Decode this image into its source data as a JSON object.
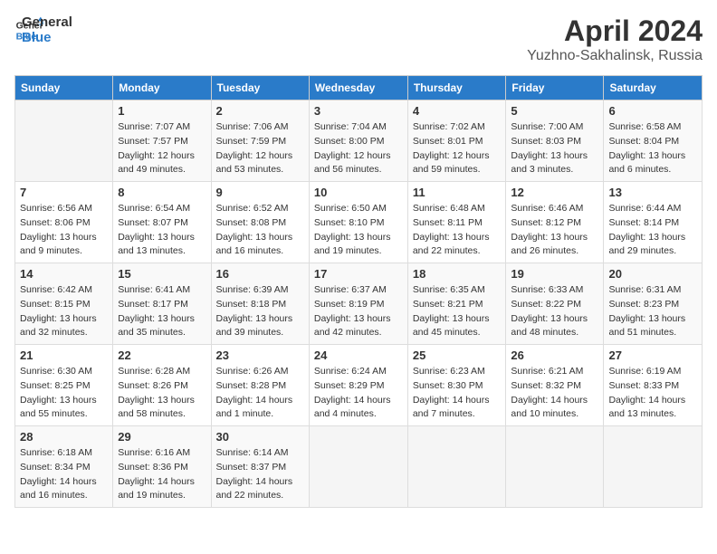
{
  "header": {
    "logo_line1": "General",
    "logo_line2": "Blue",
    "month_year": "April 2024",
    "location": "Yuzhno-Sakhalinsk, Russia"
  },
  "weekdays": [
    "Sunday",
    "Monday",
    "Tuesday",
    "Wednesday",
    "Thursday",
    "Friday",
    "Saturday"
  ],
  "weeks": [
    [
      {
        "day": "",
        "sunrise": "",
        "sunset": "",
        "daylight": ""
      },
      {
        "day": "1",
        "sunrise": "Sunrise: 7:07 AM",
        "sunset": "Sunset: 7:57 PM",
        "daylight": "Daylight: 12 hours and 49 minutes."
      },
      {
        "day": "2",
        "sunrise": "Sunrise: 7:06 AM",
        "sunset": "Sunset: 7:59 PM",
        "daylight": "Daylight: 12 hours and 53 minutes."
      },
      {
        "day": "3",
        "sunrise": "Sunrise: 7:04 AM",
        "sunset": "Sunset: 8:00 PM",
        "daylight": "Daylight: 12 hours and 56 minutes."
      },
      {
        "day": "4",
        "sunrise": "Sunrise: 7:02 AM",
        "sunset": "Sunset: 8:01 PM",
        "daylight": "Daylight: 12 hours and 59 minutes."
      },
      {
        "day": "5",
        "sunrise": "Sunrise: 7:00 AM",
        "sunset": "Sunset: 8:03 PM",
        "daylight": "Daylight: 13 hours and 3 minutes."
      },
      {
        "day": "6",
        "sunrise": "Sunrise: 6:58 AM",
        "sunset": "Sunset: 8:04 PM",
        "daylight": "Daylight: 13 hours and 6 minutes."
      }
    ],
    [
      {
        "day": "7",
        "sunrise": "Sunrise: 6:56 AM",
        "sunset": "Sunset: 8:06 PM",
        "daylight": "Daylight: 13 hours and 9 minutes."
      },
      {
        "day": "8",
        "sunrise": "Sunrise: 6:54 AM",
        "sunset": "Sunset: 8:07 PM",
        "daylight": "Daylight: 13 hours and 13 minutes."
      },
      {
        "day": "9",
        "sunrise": "Sunrise: 6:52 AM",
        "sunset": "Sunset: 8:08 PM",
        "daylight": "Daylight: 13 hours and 16 minutes."
      },
      {
        "day": "10",
        "sunrise": "Sunrise: 6:50 AM",
        "sunset": "Sunset: 8:10 PM",
        "daylight": "Daylight: 13 hours and 19 minutes."
      },
      {
        "day": "11",
        "sunrise": "Sunrise: 6:48 AM",
        "sunset": "Sunset: 8:11 PM",
        "daylight": "Daylight: 13 hours and 22 minutes."
      },
      {
        "day": "12",
        "sunrise": "Sunrise: 6:46 AM",
        "sunset": "Sunset: 8:12 PM",
        "daylight": "Daylight: 13 hours and 26 minutes."
      },
      {
        "day": "13",
        "sunrise": "Sunrise: 6:44 AM",
        "sunset": "Sunset: 8:14 PM",
        "daylight": "Daylight: 13 hours and 29 minutes."
      }
    ],
    [
      {
        "day": "14",
        "sunrise": "Sunrise: 6:42 AM",
        "sunset": "Sunset: 8:15 PM",
        "daylight": "Daylight: 13 hours and 32 minutes."
      },
      {
        "day": "15",
        "sunrise": "Sunrise: 6:41 AM",
        "sunset": "Sunset: 8:17 PM",
        "daylight": "Daylight: 13 hours and 35 minutes."
      },
      {
        "day": "16",
        "sunrise": "Sunrise: 6:39 AM",
        "sunset": "Sunset: 8:18 PM",
        "daylight": "Daylight: 13 hours and 39 minutes."
      },
      {
        "day": "17",
        "sunrise": "Sunrise: 6:37 AM",
        "sunset": "Sunset: 8:19 PM",
        "daylight": "Daylight: 13 hours and 42 minutes."
      },
      {
        "day": "18",
        "sunrise": "Sunrise: 6:35 AM",
        "sunset": "Sunset: 8:21 PM",
        "daylight": "Daylight: 13 hours and 45 minutes."
      },
      {
        "day": "19",
        "sunrise": "Sunrise: 6:33 AM",
        "sunset": "Sunset: 8:22 PM",
        "daylight": "Daylight: 13 hours and 48 minutes."
      },
      {
        "day": "20",
        "sunrise": "Sunrise: 6:31 AM",
        "sunset": "Sunset: 8:23 PM",
        "daylight": "Daylight: 13 hours and 51 minutes."
      }
    ],
    [
      {
        "day": "21",
        "sunrise": "Sunrise: 6:30 AM",
        "sunset": "Sunset: 8:25 PM",
        "daylight": "Daylight: 13 hours and 55 minutes."
      },
      {
        "day": "22",
        "sunrise": "Sunrise: 6:28 AM",
        "sunset": "Sunset: 8:26 PM",
        "daylight": "Daylight: 13 hours and 58 minutes."
      },
      {
        "day": "23",
        "sunrise": "Sunrise: 6:26 AM",
        "sunset": "Sunset: 8:28 PM",
        "daylight": "Daylight: 14 hours and 1 minute."
      },
      {
        "day": "24",
        "sunrise": "Sunrise: 6:24 AM",
        "sunset": "Sunset: 8:29 PM",
        "daylight": "Daylight: 14 hours and 4 minutes."
      },
      {
        "day": "25",
        "sunrise": "Sunrise: 6:23 AM",
        "sunset": "Sunset: 8:30 PM",
        "daylight": "Daylight: 14 hours and 7 minutes."
      },
      {
        "day": "26",
        "sunrise": "Sunrise: 6:21 AM",
        "sunset": "Sunset: 8:32 PM",
        "daylight": "Daylight: 14 hours and 10 minutes."
      },
      {
        "day": "27",
        "sunrise": "Sunrise: 6:19 AM",
        "sunset": "Sunset: 8:33 PM",
        "daylight": "Daylight: 14 hours and 13 minutes."
      }
    ],
    [
      {
        "day": "28",
        "sunrise": "Sunrise: 6:18 AM",
        "sunset": "Sunset: 8:34 PM",
        "daylight": "Daylight: 14 hours and 16 minutes."
      },
      {
        "day": "29",
        "sunrise": "Sunrise: 6:16 AM",
        "sunset": "Sunset: 8:36 PM",
        "daylight": "Daylight: 14 hours and 19 minutes."
      },
      {
        "day": "30",
        "sunrise": "Sunrise: 6:14 AM",
        "sunset": "Sunset: 8:37 PM",
        "daylight": "Daylight: 14 hours and 22 minutes."
      },
      {
        "day": "",
        "sunrise": "",
        "sunset": "",
        "daylight": ""
      },
      {
        "day": "",
        "sunrise": "",
        "sunset": "",
        "daylight": ""
      },
      {
        "day": "",
        "sunrise": "",
        "sunset": "",
        "daylight": ""
      },
      {
        "day": "",
        "sunrise": "",
        "sunset": "",
        "daylight": ""
      }
    ]
  ]
}
